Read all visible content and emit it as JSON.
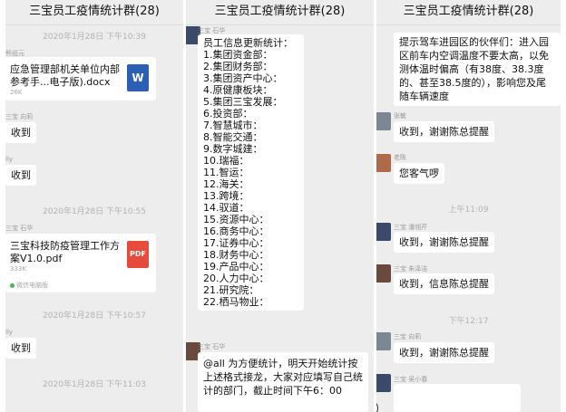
{
  "panel1": {
    "title": "三宝员工疫情统计群(28)",
    "ts1": "2020年1月28日 下午10:39",
    "msg1_sender": "熊组元",
    "file1": {
      "name": "应急管理部机关单位内部参考手...电子版).docx",
      "size": "26K",
      "icon": "W"
    },
    "msg2_sender": "三宝 向莉",
    "msg2_text": "收到",
    "msg3_sender": "lly",
    "msg3_text": "收到",
    "ts2": "2020年1月28日 下午10:55",
    "msg4_sender": "三宝 石华",
    "file2": {
      "name": "三宝科技防疫管理工作方案V1.0.pdf",
      "size": "333K",
      "icon": "PDF",
      "source": "微信电脑版"
    },
    "ts3": "2020年1月28日 下午10:57",
    "msg5_sender": "lly",
    "msg5_text": "收到",
    "ts4": "2020年1月28日 下午11:03"
  },
  "panel2": {
    "title": "三宝员工疫情统计群(28)",
    "msg1_sender": "三宝 石华",
    "list_heading": "员工信息更新统计：",
    "list_items": [
      "1.集团资金部：",
      "2.集团财务部：",
      "3.集团资产中心：",
      "4.原健康板块：",
      "5.集团三宝发展：",
      "6.投资部：",
      "7.智慧城市：",
      "8.智能交通：",
      "9.数字城建：",
      "10.瑞福：",
      "11.智运：",
      "12.海关：",
      "13.跨境：",
      "14.驭道：",
      "15.资源中心：",
      "16.商务中心：",
      "17.证券中心：",
      "18.财务中心：",
      "19.产品中心：",
      "20.人力中心：",
      "21.研究院：",
      "22.栖马物业："
    ],
    "msg2_sender": "三宝 石华",
    "msg2_text": "@all 为方便统计，明天开始统计按上述格式接龙，大家对应填写自己统计的部门，截止时间下午6：00"
  },
  "panel3": {
    "title": "三宝员工疫情统计群(28)",
    "msg1_text": "提示驾车进园区的伙伴们：进入园区前车内空调温度不要太高，以免测体温时偏高（有38度、38.3度的、甚至38.5度的），影响您及尾随车辆速度",
    "msg2_sender": "张敏",
    "msg2_text": "收到，谢谢陈总提醒",
    "msg3_sender": "老陈",
    "msg3_text": "您客气啰",
    "ts1": "上午11:09",
    "msg4_sender": "三宝 潘翎芹",
    "msg4_text": "收到，谢谢陈总提醒",
    "msg5_sender": "三宝 朱泽洁",
    "msg5_text": "收到，信息陈总提醒",
    "ts2": "下午12:17",
    "msg6_sender": "三宝 向莉",
    "msg6_text": "收到，谢谢陈总提醒",
    "msg7_sender": "三宝 吴小春"
  }
}
